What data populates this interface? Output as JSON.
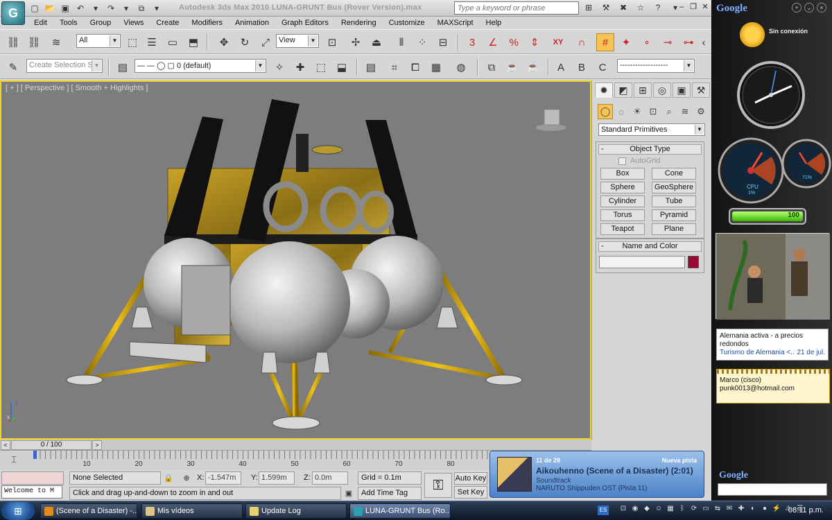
{
  "window": {
    "title": "Autodesk 3ds Max  2010      LUNA-GRUNT Bus (Rover Version).max",
    "search_placeholder": "Type a keyword or phrase",
    "logo_glyph": "G"
  },
  "menu": [
    "Edit",
    "Tools",
    "Group",
    "Views",
    "Create",
    "Modifiers",
    "Animation",
    "Graph Editors",
    "Rendering",
    "Customize",
    "MAXScript",
    "Help"
  ],
  "toolbar": {
    "selection_filter": "All",
    "ref_coord": "View",
    "named_selection": "Create Selection Se",
    "layer": "0 (default)",
    "snap_labels": {
      "snap3": "3",
      "angle": "∠",
      "percent": "%",
      "xy": "XY"
    }
  },
  "viewport": {
    "label": "[ + ] [ Perspective ] [ Smooth + Highlights ]",
    "axis_z": "z",
    "axis_x": "x"
  },
  "command_panel": {
    "category": "Standard Primitives",
    "object_type_title": "Object Type",
    "autogrid_label": "AutoGrid",
    "buttons": [
      "Box",
      "Cone",
      "Sphere",
      "GeoSphere",
      "Cylinder",
      "Tube",
      "Torus",
      "Pyramid",
      "Teapot",
      "Plane"
    ],
    "name_color_title": "Name and Color",
    "object_color": "#9a0a35"
  },
  "timeline": {
    "slider": "0 / 100",
    "ticks": [
      "10",
      "20",
      "30",
      "40",
      "50",
      "60",
      "70",
      "80"
    ]
  },
  "status": {
    "selection": "None Selected",
    "prompt": "Click and drag up-and-down to zoom in and out",
    "welcome": "Welcome to M",
    "x_label": "X:",
    "x_value": "-1.547m",
    "y_label": "Y:",
    "y_value": "1.599m",
    "z_label": "Z:",
    "z_value": "0.0m",
    "grid": "Grid = 0.1m",
    "add_time_tag": "Add Time Tag",
    "auto_key": "Auto Key",
    "set_key": "Set Key"
  },
  "music_popup": {
    "track_index": "11 de 28",
    "badge": "Nueva pista",
    "title": "Aikouhenno (Scene of a Disaster) (2:01)",
    "genre": "Soundtrack",
    "album": "NARUTO Shippuden OST (Pista 11)"
  },
  "sidebar": {
    "logo": "Google",
    "weather_status": "Sin conexión",
    "cpu_label": "CPU",
    "cpu_value": "1%",
    "mem_value": "71%",
    "battery_value": "100",
    "battery_level": 1.0,
    "news_text": "Alemania activa - a precios redondos",
    "news_source": "Turismo de Alemania <..",
    "news_date": "21 de jul.",
    "contact_name": "Marco (cisco)",
    "contact_email": "punk0013@hotmail.com",
    "search_logo": "Google"
  },
  "taskbar": {
    "tasks": [
      "(Scene of a Disaster) -...",
      "Mis vídeos",
      "Update Log",
      "LUNA-GRUNT Bus (Ro..."
    ],
    "language": "ES",
    "clock": "08:11 p.m."
  }
}
